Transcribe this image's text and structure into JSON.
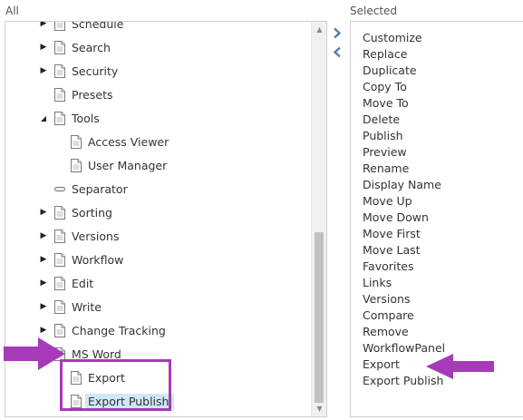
{
  "labels": {
    "all": "All",
    "selected": "Selected"
  },
  "tree": [
    {
      "label": "Schedule",
      "icon": "document",
      "toggle": "collapsed",
      "level": 0
    },
    {
      "label": "Search",
      "icon": "document",
      "toggle": "collapsed",
      "level": 0
    },
    {
      "label": "Security",
      "icon": "document",
      "toggle": "collapsed",
      "level": 0
    },
    {
      "label": "Presets",
      "icon": "document",
      "toggle": "none",
      "level": 0
    },
    {
      "label": "Tools",
      "icon": "document",
      "toggle": "expanded",
      "level": 0
    },
    {
      "label": "Access Viewer",
      "icon": "document",
      "toggle": "none",
      "level": 1
    },
    {
      "label": "User Manager",
      "icon": "document",
      "toggle": "none",
      "level": 1
    },
    {
      "label": "Separator",
      "icon": "separator",
      "toggle": "none",
      "level": 0
    },
    {
      "label": "Sorting",
      "icon": "document",
      "toggle": "collapsed",
      "level": 0
    },
    {
      "label": "Versions",
      "icon": "document",
      "toggle": "collapsed",
      "level": 0
    },
    {
      "label": "Workflow",
      "icon": "document",
      "toggle": "collapsed",
      "level": 0
    },
    {
      "label": "Edit",
      "icon": "document",
      "toggle": "collapsed",
      "level": 0
    },
    {
      "label": "Write",
      "icon": "document",
      "toggle": "collapsed",
      "level": 0
    },
    {
      "label": "Change Tracking",
      "icon": "document",
      "toggle": "collapsed",
      "level": 0
    },
    {
      "label": "MS Word",
      "icon": "document",
      "toggle": "expanded",
      "level": 0
    },
    {
      "label": "Export",
      "icon": "document",
      "toggle": "none",
      "level": 1
    },
    {
      "label": "Export Publish",
      "icon": "document",
      "toggle": "none",
      "level": 1,
      "selected": true
    }
  ],
  "selected_items": [
    "Customize",
    "Replace",
    "Duplicate",
    "Copy To",
    "Move To",
    "Delete",
    "Publish",
    "Preview",
    "Rename",
    "Display Name",
    "Move Up",
    "Move Down",
    "Move First",
    "Move Last",
    "Favorites",
    "Links",
    "Versions",
    "Compare",
    "Remove",
    "WorkflowPanel",
    "Export",
    "Export Publish"
  ],
  "colors": {
    "accent_arrow": "#a63ab8",
    "move_button": "#4a7fb5",
    "selection": "#cfe8f7",
    "scroll_thumb": "#c1c1c1"
  }
}
